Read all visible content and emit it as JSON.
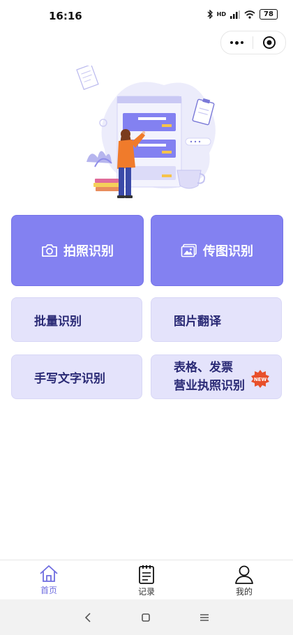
{
  "status_bar": {
    "time": "16:16",
    "battery": "78",
    "network": "HD"
  },
  "main_buttons": [
    {
      "label": "拍照识别",
      "icon": "camera-icon"
    },
    {
      "label": "传图识别",
      "icon": "image-icon"
    }
  ],
  "grid_buttons": [
    {
      "lines": [
        "批量识别"
      ]
    },
    {
      "lines": [
        "图片翻译"
      ]
    },
    {
      "lines": [
        "手写文字识别"
      ]
    },
    {
      "lines": [
        "表格、发票",
        "营业执照识别"
      ],
      "badge": "NEW"
    }
  ],
  "tabbar": [
    {
      "label": "首页",
      "icon": "home-icon",
      "active": true
    },
    {
      "label": "记录",
      "icon": "notepad-icon",
      "active": false
    },
    {
      "label": "我的",
      "icon": "user-icon",
      "active": false
    }
  ],
  "colors": {
    "primary": "#8381f1",
    "secondary_bg": "#e4e3fb",
    "secondary_text": "#2a2a75",
    "active_tab": "#6f6de0"
  }
}
